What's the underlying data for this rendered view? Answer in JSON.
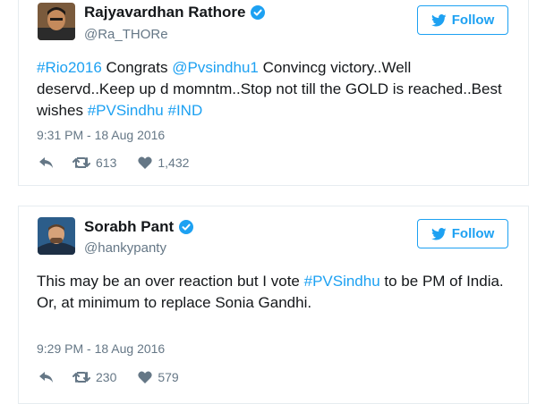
{
  "colors": {
    "accent": "#1da1f2",
    "text": "#14171a",
    "secondary": "#657786",
    "border": "#e6ecf0",
    "verified": "#1da1f2"
  },
  "tweets": [
    {
      "author": "Rajyavardhan Rathore",
      "handle": "@Ra_THORe",
      "verified_icon": "verified-badge-icon",
      "follow_label": "Follow",
      "text": [
        {
          "t": "#Rio2016",
          "link": true
        },
        {
          "t": " Congrats ",
          "link": false
        },
        {
          "t": "@Pvsindhu1",
          "link": true
        },
        {
          "t": " Convincg victory..Well deservd..Keep up d momntm..Stop not till the GOLD is reached..Best wishes ",
          "link": false
        },
        {
          "t": "#PVSindhu",
          "link": true
        },
        {
          "t": " ",
          "link": false
        },
        {
          "t": "#IND",
          "link": true
        }
      ],
      "timestamp": "9:31 PM - 18 Aug 2016",
      "retweets": "613",
      "likes": "1,432"
    },
    {
      "author": "Sorabh Pant",
      "handle": "@hankypanty",
      "verified_icon": "verified-badge-icon",
      "follow_label": "Follow",
      "text": [
        {
          "t": "This may be an over reaction but I vote ",
          "link": false
        },
        {
          "t": "#PVSindhu",
          "link": true
        },
        {
          "t": " to be PM of India.",
          "link": false
        },
        {
          "t": "\n",
          "link": false
        },
        {
          "t": "Or, at minimum to replace Sonia Gandhi.",
          "link": false
        }
      ],
      "timestamp": "9:29 PM - 18 Aug 2016",
      "retweets": "230",
      "likes": "579"
    }
  ]
}
